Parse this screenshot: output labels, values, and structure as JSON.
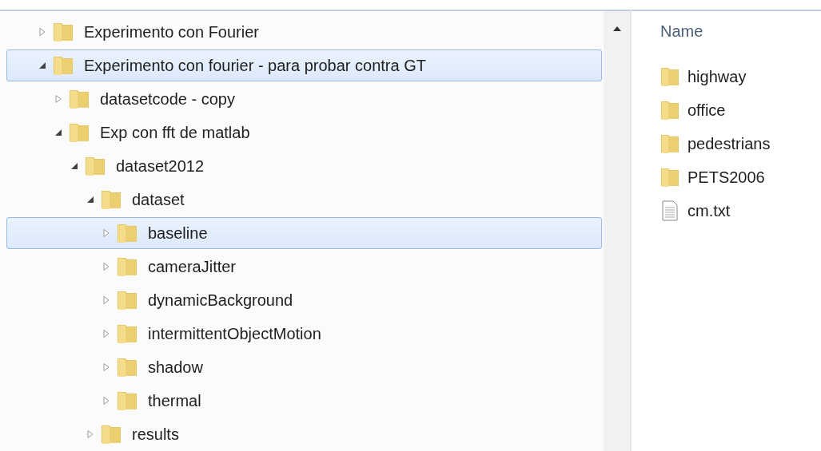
{
  "navigation_tree": [
    {
      "label": "Experimento con Fourier",
      "expanded": false,
      "selected": false
    },
    {
      "label": "Experimento con fourier - para probar contra GT",
      "expanded": true,
      "selected": true,
      "children": [
        {
          "label": "datasetcode - copy",
          "expanded": false,
          "selected": false
        },
        {
          "label": "Exp con fft de matlab",
          "expanded": true,
          "selected": false,
          "children": [
            {
              "label": "dataset2012",
              "expanded": true,
              "selected": false,
              "children": [
                {
                  "label": "dataset",
                  "expanded": true,
                  "selected": false,
                  "children": [
                    {
                      "label": "baseline",
                      "expanded": false,
                      "selected": true
                    },
                    {
                      "label": "cameraJitter",
                      "expanded": false,
                      "selected": false
                    },
                    {
                      "label": "dynamicBackground",
                      "expanded": false,
                      "selected": false
                    },
                    {
                      "label": "intermittentObjectMotion",
                      "expanded": false,
                      "selected": false
                    },
                    {
                      "label": "shadow",
                      "expanded": false,
                      "selected": false
                    },
                    {
                      "label": "thermal",
                      "expanded": false,
                      "selected": false
                    }
                  ]
                },
                {
                  "label": "results",
                  "expanded": false,
                  "selected": false
                }
              ]
            }
          ]
        }
      ]
    }
  ],
  "file_list": {
    "column_header": "Name",
    "items": [
      {
        "name": "highway",
        "kind": "folder"
      },
      {
        "name": "office",
        "kind": "folder"
      },
      {
        "name": "pedestrians",
        "kind": "folder"
      },
      {
        "name": "PETS2006",
        "kind": "folder"
      },
      {
        "name": "cm.txt",
        "kind": "file"
      }
    ]
  }
}
